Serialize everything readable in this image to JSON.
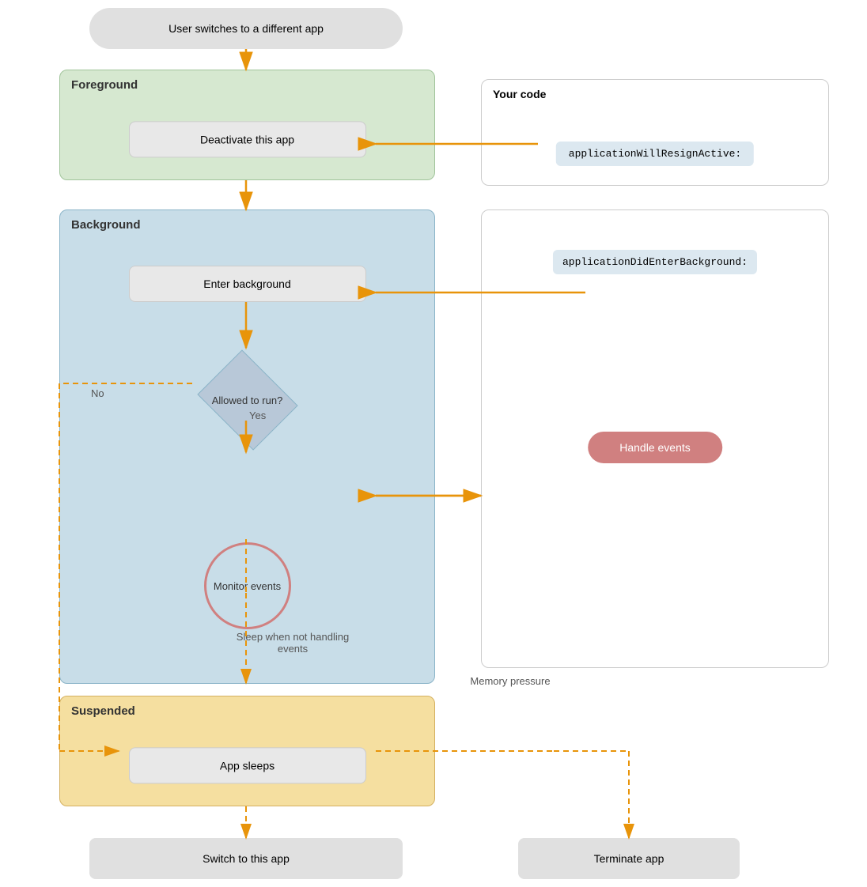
{
  "nodes": {
    "userSwitches": "User switches to a different app",
    "deactivate": "Deactivate this app",
    "enterBackground": "Enter background",
    "allowedToRun": "Allowed\nto run?",
    "monitorEvents": "Monitor\nevents",
    "handleEvents": "Handle events",
    "appSleeps": "App sleeps",
    "switchToApp": "Switch to this app",
    "terminateApp": "Terminate app"
  },
  "sections": {
    "foreground": {
      "label": "Foreground"
    },
    "background": {
      "label": "Background"
    },
    "suspended": {
      "label": "Suspended"
    }
  },
  "rightPanels": {
    "yourCode": {
      "label": "Your code",
      "code1": "applicationWillResignActive:"
    },
    "background": {
      "code1": "applicationDidEnterBackground:"
    }
  },
  "labels": {
    "no": "No",
    "yes": "Yes",
    "sleep": "Sleep when not\nhandling events",
    "memory": "Memory pressure"
  }
}
